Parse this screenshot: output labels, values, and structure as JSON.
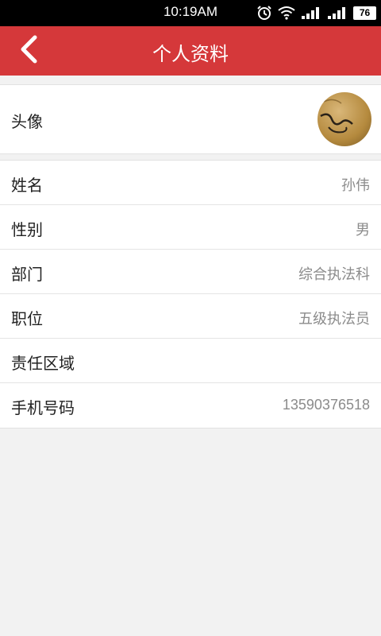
{
  "status_bar": {
    "time": "10:19AM",
    "battery": "76",
    "icons": [
      "alarm-icon",
      "wifi-icon",
      "signal-icon",
      "signal-2-icon",
      "battery-icon"
    ]
  },
  "app_bar": {
    "title": "个人资料",
    "back_icon": "back-chevron-icon",
    "color": "#d5383a"
  },
  "avatar_row": {
    "label": "头像"
  },
  "profile": {
    "rows": [
      {
        "label": "姓名",
        "value": "孙伟"
      },
      {
        "label": "性别",
        "value": "男"
      },
      {
        "label": "部门",
        "value": "综合执法科"
      },
      {
        "label": "职位",
        "value": "五级执法员"
      },
      {
        "label": "责任区域",
        "value": ""
      },
      {
        "label": "手机号码",
        "value": "13590376518"
      }
    ]
  }
}
